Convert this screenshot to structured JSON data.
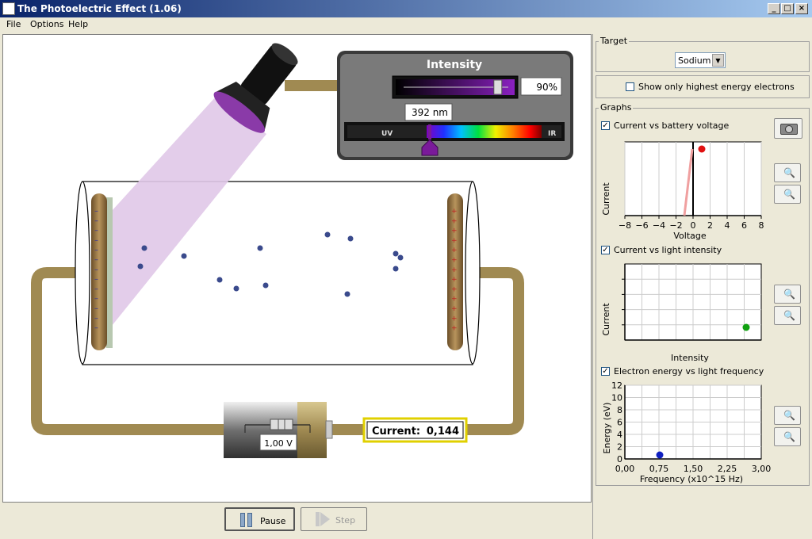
{
  "window": {
    "title": "The Photoelectric Effect (1.06)"
  },
  "menu": [
    "File",
    "Options",
    "Help"
  ],
  "lamp": {
    "intensity_label": "Intensity",
    "intensity_value": "90%",
    "intensity_fraction": 0.9,
    "wavelength_value": "392 nm",
    "uv_label": "UV",
    "ir_label": "IR"
  },
  "battery": {
    "voltage": "1,00 V"
  },
  "current_readout": {
    "label": "Current:",
    "value": "0,144"
  },
  "controls": {
    "pause_label": "Pause",
    "step_label": "Step"
  },
  "target": {
    "group_title": "Target",
    "selected": "Sodium",
    "highest_energy_label": "Show only highest energy electrons",
    "highest_energy_checked": false
  },
  "graphs": {
    "group_title": "Graphs",
    "graph1": {
      "check_label": "Current vs battery voltage",
      "checked": true,
      "ylabel": "Current",
      "xlabel": "Voltage",
      "x_ticks": [
        "−8",
        "−6",
        "−4",
        "−2",
        "0",
        "2",
        "4",
        "6",
        "8"
      ]
    },
    "graph2": {
      "check_label": "Current vs light intensity",
      "checked": true,
      "ylabel": "Current",
      "xlabel": "Intensity"
    },
    "graph3": {
      "check_label": "Electron energy vs light frequency",
      "checked": true,
      "ylabel": "Energy (eV)",
      "xlabel": "Frequency (x10^15 Hz)",
      "x_ticks": [
        "0,00",
        "0,75",
        "1,50",
        "2,25",
        "3,00"
      ],
      "y_ticks": [
        "0",
        "2",
        "4",
        "6",
        "8",
        "10",
        "12"
      ]
    }
  },
  "colors": {
    "wire": "#a08a52",
    "plate": "#8a6b3c",
    "electron": "#3a4a8c",
    "point_red": "#e01010",
    "point_green": "#10a010",
    "point_blue": "#1020c0",
    "readout_border": "#e0d000"
  }
}
